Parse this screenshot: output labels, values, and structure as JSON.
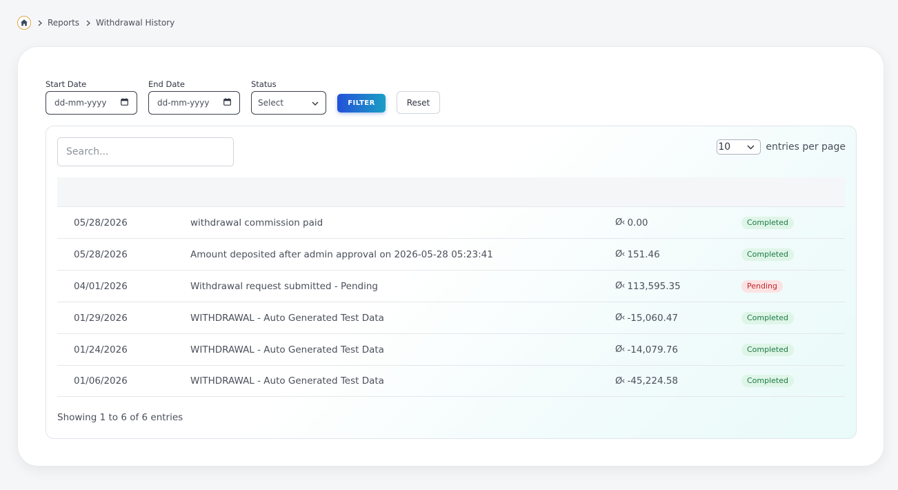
{
  "breadcrumb": {
    "home_icon": "home-icon",
    "items": [
      "Reports",
      "Withdrawal History"
    ]
  },
  "filters": {
    "start_date": {
      "label": "Start Date",
      "placeholder": "dd-mm-yyyy"
    },
    "end_date": {
      "label": "End Date",
      "placeholder": "dd-mm-yyyy"
    },
    "status": {
      "label": "Status",
      "selected": "Select"
    },
    "filter_label": "FILTER",
    "reset_label": "Reset"
  },
  "table": {
    "search_placeholder": "Search...",
    "entries_value": "10",
    "entries_suffix": "entries per page",
    "currency_symbol": "Ø‹",
    "rows": [
      {
        "date": "05/28/2026",
        "description": "withdrawal commission paid",
        "amount": "0.00",
        "status": "Completed"
      },
      {
        "date": "05/28/2026",
        "description": "Amount deposited after admin approval on 2026-05-28 05:23:41",
        "amount": "151.46",
        "status": "Completed"
      },
      {
        "date": "04/01/2026",
        "description": "Withdrawal request submitted - Pending",
        "amount": "113,595.35",
        "status": "Pending"
      },
      {
        "date": "01/29/2026",
        "description": "WITHDRAWAL - Auto Generated Test Data",
        "amount": "-15,060.47",
        "status": "Completed"
      },
      {
        "date": "01/24/2026",
        "description": "WITHDRAWAL - Auto Generated Test Data",
        "amount": "-14,079.76",
        "status": "Completed"
      },
      {
        "date": "01/06/2026",
        "description": "WITHDRAWAL - Auto Generated Test Data",
        "amount": "-45,224.58",
        "status": "Completed"
      }
    ],
    "info": "Showing 1 to 6 of 6 entries"
  },
  "colors": {
    "accent_start": "#2350d8",
    "accent_end": "#1a9fc4",
    "completed_bg": "#dff5e8",
    "completed_text": "#1c7a46",
    "pending_bg": "#fde2e2",
    "pending_text": "#c0262d"
  }
}
